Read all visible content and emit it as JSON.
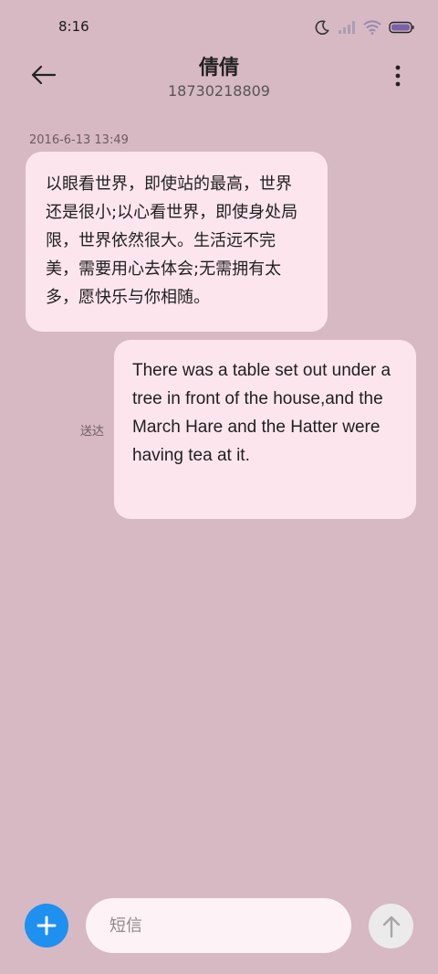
{
  "status_bar": {
    "time": "8:16",
    "icons": [
      "moon-icon",
      "signal-icon",
      "wifi-icon",
      "battery-icon"
    ]
  },
  "header": {
    "contact_name": "倩倩",
    "contact_number": "18730218809"
  },
  "conversation": {
    "timestamp": "2016-6-13 13:49",
    "messages": [
      {
        "direction": "incoming",
        "text": "以眼看世界，即使站的最高，世界还是很小;以心看世界，即使身处局限，世界依然很大。生活远不完美，需要用心去体会;无需拥有太多，愿快乐与你相随。"
      },
      {
        "direction": "outgoing",
        "text": "There was a table set out under a tree in front of the house,and the March Hare and the Hatter were having tea at it.",
        "status": "送达"
      }
    ]
  },
  "composer": {
    "placeholder": "短信",
    "value": ""
  },
  "colors": {
    "background": "#d7b9c3",
    "bubble": "#fde5ee",
    "accent": "#1e90f0"
  }
}
